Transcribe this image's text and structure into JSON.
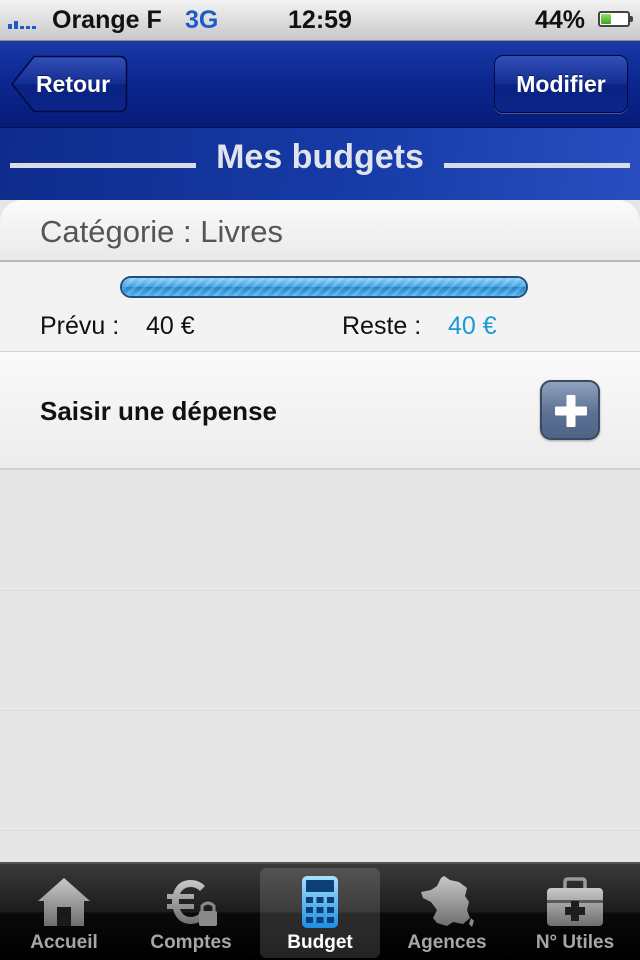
{
  "status_bar": {
    "carrier": "Orange F",
    "network": "3G",
    "time": "12:59",
    "battery_percent_text": "44%",
    "battery_level": 0.44,
    "signal_bars_on": 2,
    "signal_bars_total": 5
  },
  "nav": {
    "back_label": "Retour",
    "edit_label": "Modifier"
  },
  "page_title": "Mes budgets",
  "category": {
    "label": "Catégorie : Livres"
  },
  "budget": {
    "planned_label": "Prévu :",
    "planned_value": "40 €",
    "remaining_label": "Reste :",
    "remaining_value": "40 €",
    "remaining_fraction": 1.0
  },
  "add_expense": {
    "label": "Saisir une dépense",
    "icon": "plus-icon"
  },
  "tabs": [
    {
      "label": "Accueil",
      "icon": "home-icon",
      "active": false
    },
    {
      "label": "Comptes",
      "icon": "euro-lock-icon",
      "active": false
    },
    {
      "label": "Budget",
      "icon": "calculator-icon",
      "active": true
    },
    {
      "label": "Agences",
      "icon": "france-map-icon",
      "active": false
    },
    {
      "label": "N° Utiles",
      "icon": "first-aid-kit-icon",
      "active": false
    }
  ],
  "colors": {
    "nav_blue": "#0c2790",
    "remaining_value": "#1a9ad6",
    "network": "#1f5bc8",
    "progress_fill": "#3b9fe0"
  }
}
